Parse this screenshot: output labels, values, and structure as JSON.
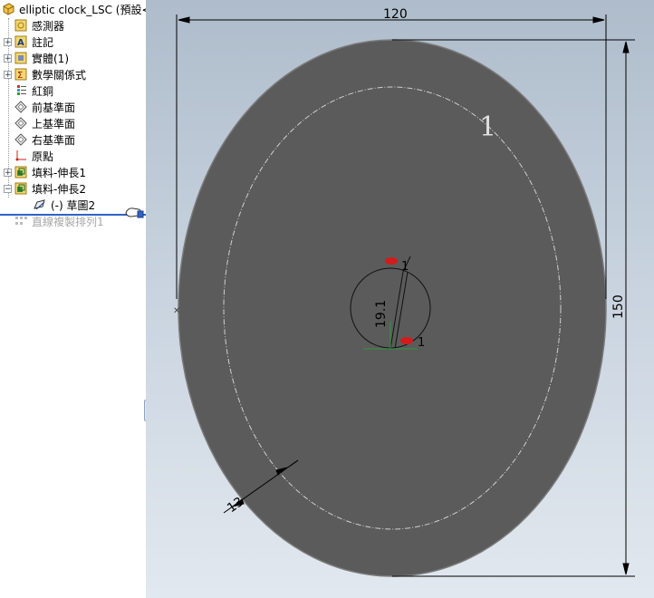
{
  "tree": {
    "root": "elliptic clock_LSC  (預設<",
    "items": [
      {
        "label": "感測器",
        "icon": "sensor-icon",
        "expandable": false
      },
      {
        "label": "註記",
        "icon": "annotation-icon",
        "expandable": true
      },
      {
        "label": "實體(1)",
        "icon": "solid-bodies-icon",
        "expandable": true
      },
      {
        "label": "數學關係式",
        "icon": "equations-icon",
        "expandable": true
      },
      {
        "label": "紅銅",
        "icon": "material-icon",
        "expandable": false
      },
      {
        "label": "前基準面",
        "icon": "plane-icon",
        "expandable": false
      },
      {
        "label": "上基準面",
        "icon": "plane-icon",
        "expandable": false
      },
      {
        "label": "右基準面",
        "icon": "plane-icon",
        "expandable": false
      },
      {
        "label": "原點",
        "icon": "origin-icon",
        "expandable": false
      },
      {
        "label": "填料-伸長1",
        "icon": "extrude-icon",
        "expandable": true
      },
      {
        "label": "填料-伸長2",
        "icon": "extrude-icon",
        "expandable": true,
        "expanded": true
      },
      {
        "label": "(-) 草圖2",
        "icon": "sketch-icon",
        "expandable": false,
        "child": true
      },
      {
        "label": "直線複製排列1",
        "icon": "linear-pattern-icon",
        "expandable": false,
        "suppressed": true
      }
    ]
  },
  "viewport": {
    "dimensions": {
      "width": "120",
      "height": "150",
      "offset": "13",
      "hand_length": "19.1",
      "small_a": "1",
      "small_b": "1"
    },
    "hour_label": "1",
    "colors": {
      "body": "#5a5a5a",
      "dimension": "#000000",
      "accent": "#2f62c6",
      "arrow_red": "#d21c1c"
    }
  }
}
